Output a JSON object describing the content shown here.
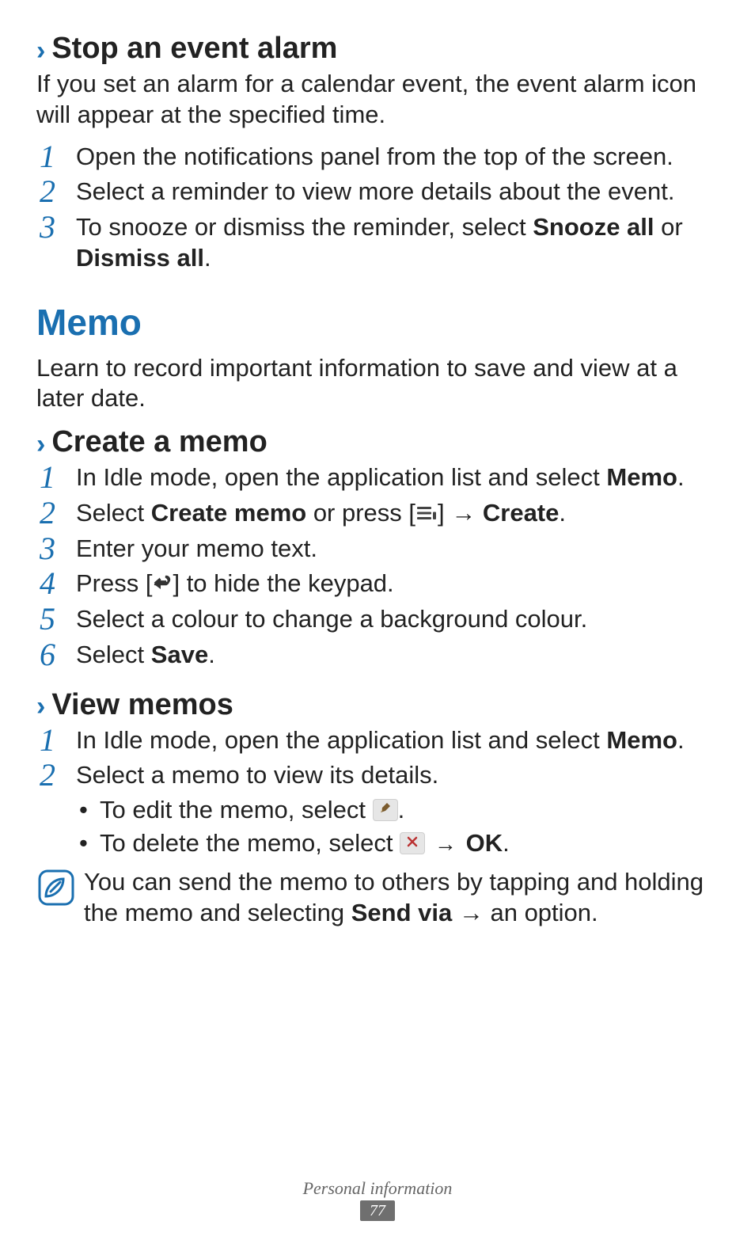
{
  "sections": {
    "stop_alarm": {
      "heading": "Stop an event alarm",
      "intro": "If you set an alarm for a calendar event, the event alarm icon will appear at the specified time.",
      "steps": {
        "s1": "Open the notifications panel from the top of the screen.",
        "s2": "Select a reminder to view more details about the event.",
        "s3_before": "To snooze or dismiss the reminder, select ",
        "s3_bold1": "Snooze all",
        "s3_mid": " or ",
        "s3_bold2": "Dismiss all",
        "s3_after": "."
      }
    },
    "memo": {
      "title": "Memo",
      "intro": "Learn to record important information to save and view at a later date."
    },
    "create_memo": {
      "heading": "Create a memo",
      "steps": {
        "s1_before": "In Idle mode, open the application list and select ",
        "s1_bold": "Memo",
        "s1_after": ".",
        "s2_before": "Select ",
        "s2_bold1": "Create memo",
        "s2_mid": " or press [",
        "s2_after_icon": "] → ",
        "s2_bold2": "Create",
        "s2_end": ".",
        "s3": "Enter your memo text.",
        "s4_before": "Press [",
        "s4_after": "] to hide the keypad.",
        "s5": "Select a colour to change a background colour.",
        "s6_before": "Select ",
        "s6_bold": "Save",
        "s6_after": "."
      }
    },
    "view_memos": {
      "heading": "View memos",
      "steps": {
        "s1_before": "In Idle mode, open the application list and select ",
        "s1_bold": "Memo",
        "s1_after": ".",
        "s2": "Select a memo to view its details.",
        "b1_before": "To edit the memo, select ",
        "b1_after": ".",
        "b2_before": "To delete the memo, select ",
        "b2_mid": " → ",
        "b2_bold": "OK",
        "b2_after": "."
      },
      "note_before": "You can send the memo to others by tapping and holding the memo and selecting  ",
      "note_bold": "Send via",
      "note_after": " → an option."
    }
  },
  "footer": {
    "chapter": "Personal information",
    "page": "77"
  }
}
